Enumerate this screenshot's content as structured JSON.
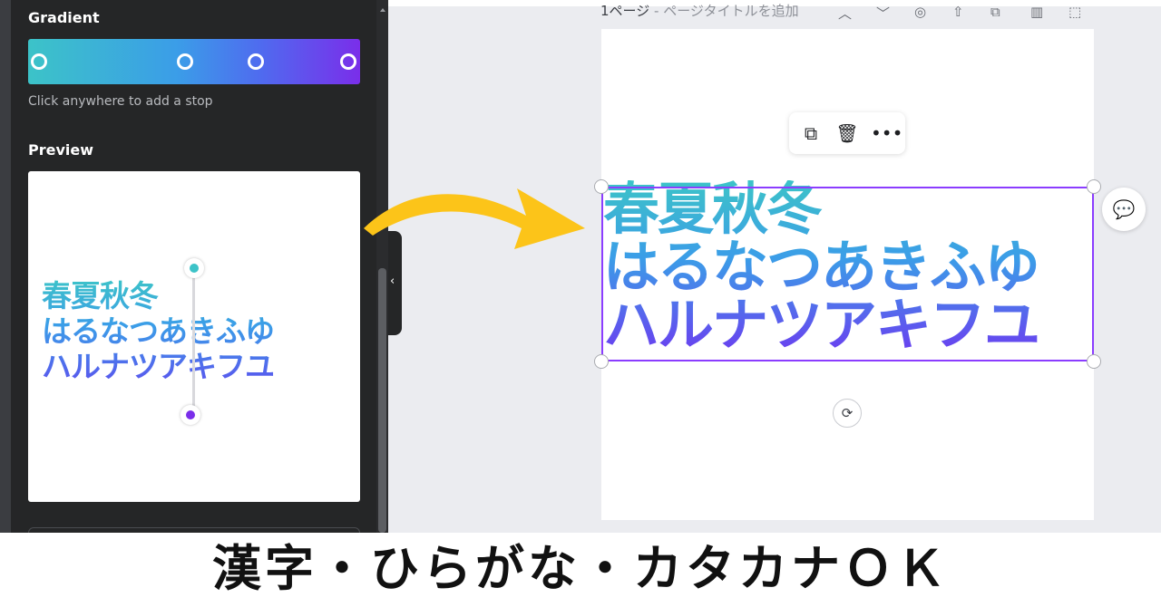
{
  "sidebar": {
    "gradient_label": "Gradient",
    "gradient_colors": [
      "#3cc3c8",
      "#3b9de8",
      "#4f6bef",
      "#7a2eea"
    ],
    "hint": "Click anywhere to add a stop",
    "preview_label": "Preview",
    "preview_lines": [
      "春夏秋冬",
      "はるなつあきふゆ",
      "ハルナツアキフユ"
    ]
  },
  "editor": {
    "page_title": "1ページ",
    "page_title_sub": " - ページタイトルを追加",
    "toolbar_icons": [
      "chevron-up-icon",
      "chevron-down-icon",
      "hide-icon",
      "upload-icon",
      "duplicate-page-icon",
      "delete-page-icon",
      "add-page-icon"
    ],
    "float_toolbar_icons": [
      "duplicate-icon",
      "trash-icon",
      "more-icon"
    ],
    "canvas_lines": [
      "春夏秋冬",
      "はるなつあきふゆ",
      "ハルナツアキフユ"
    ]
  },
  "caption": "漢字・ひらがな・カタカナＯＫ",
  "colors": {
    "accent_selection": "#8b3dff",
    "arrow": "#fcc419",
    "panel_bg": "#252627"
  }
}
